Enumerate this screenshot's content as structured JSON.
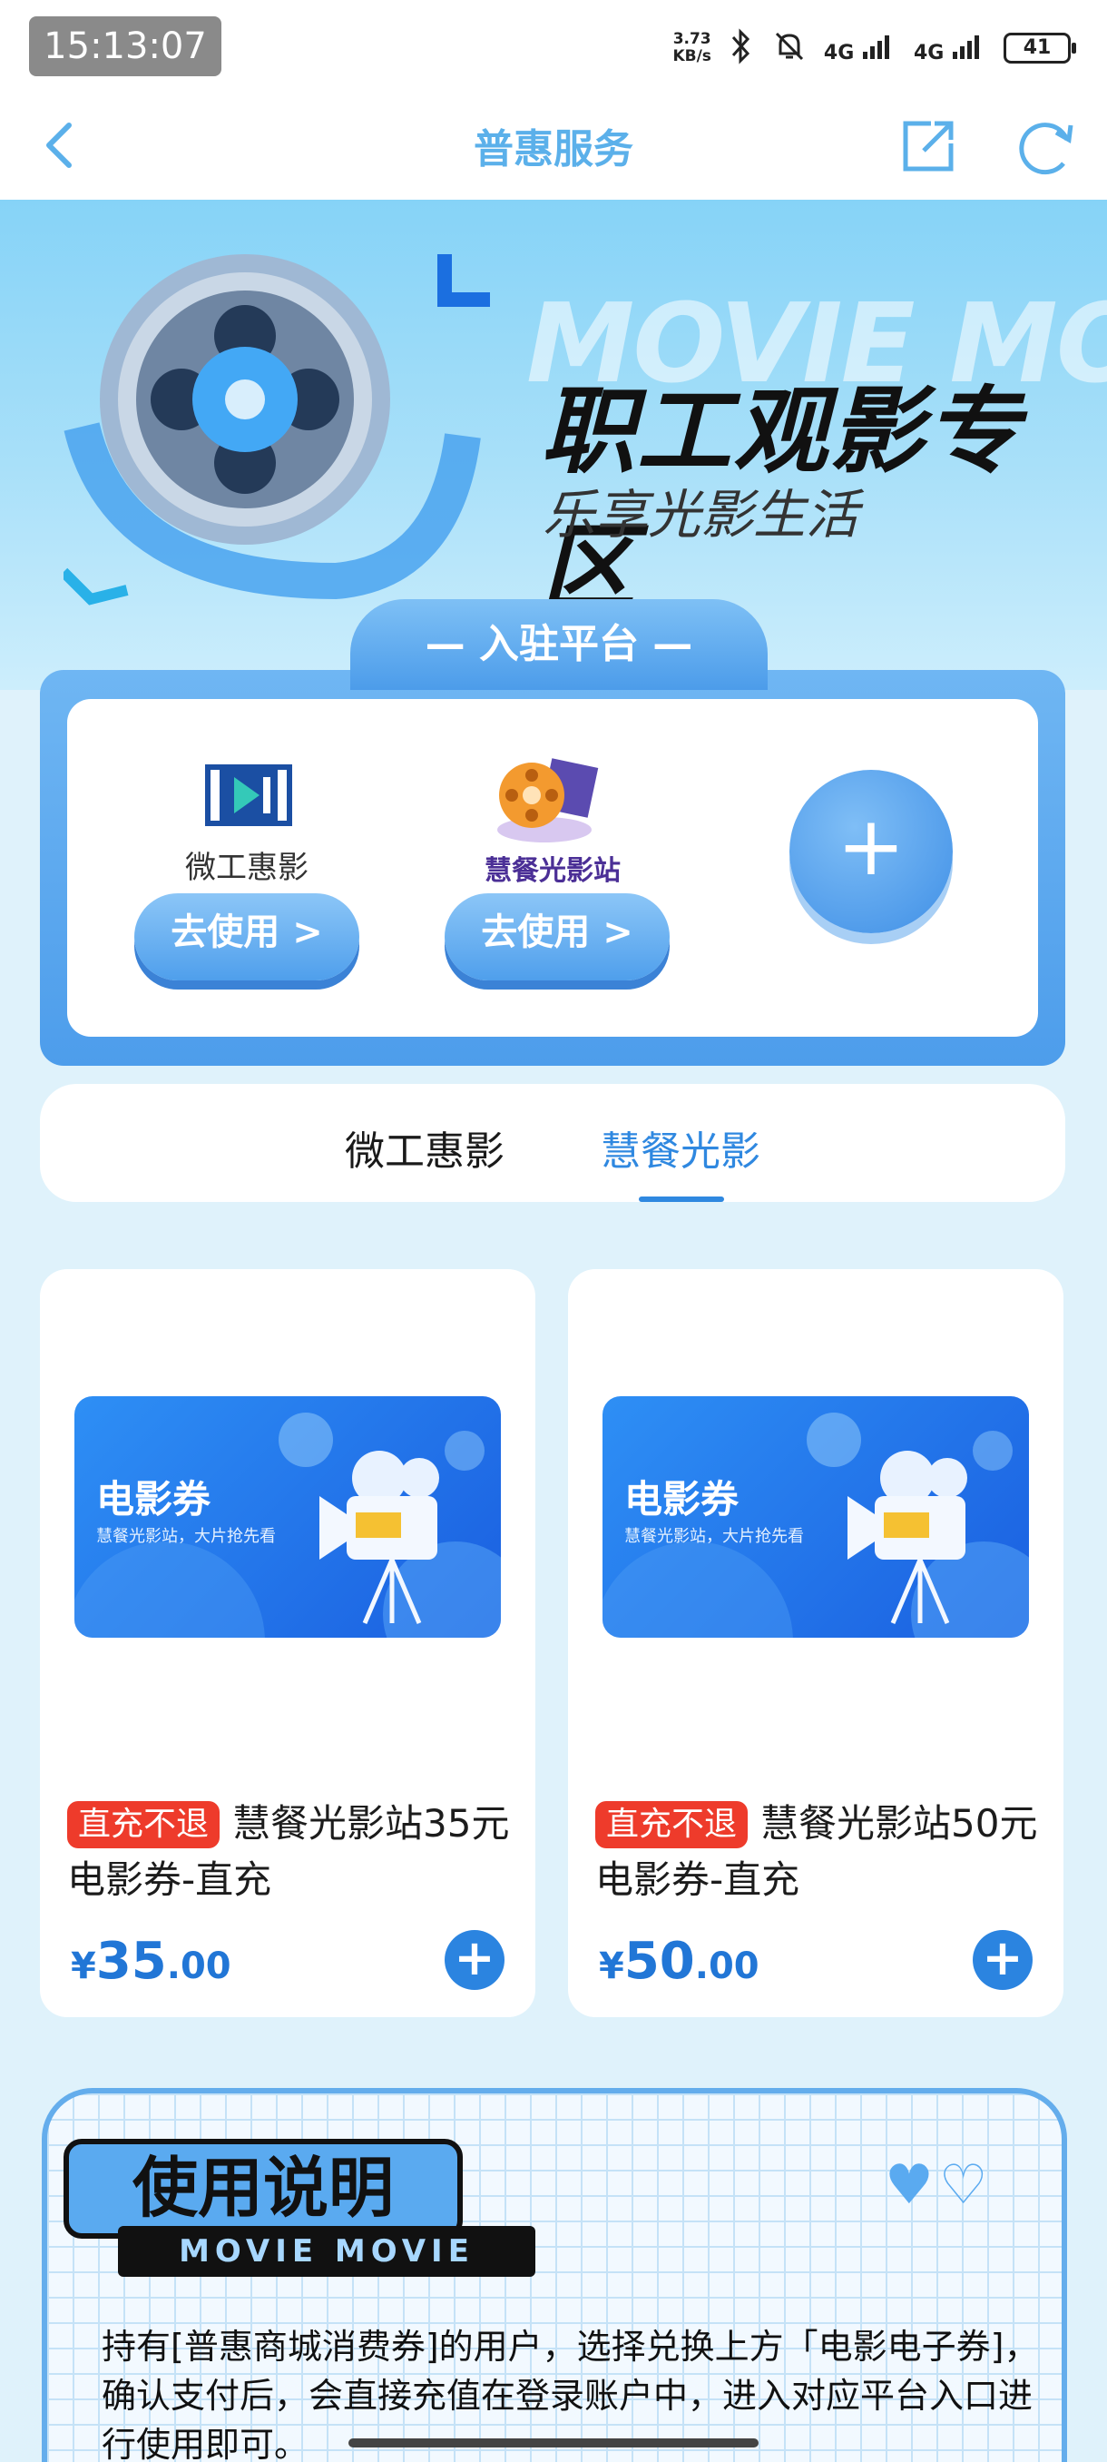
{
  "status": {
    "time": "15:13:07",
    "speed_top": "3.73",
    "speed_bottom": "KB/s",
    "sig1": "4G",
    "sig2": "4G",
    "battery": "41"
  },
  "nav": {
    "title": "普惠服务"
  },
  "hero": {
    "bg_text": "MOVIE MOVIE",
    "title": "职工观影专区",
    "subtitle": "乐享光影生活"
  },
  "platforms": {
    "header": "— 入驻平台 —",
    "items": [
      {
        "name": "微工惠影",
        "button": "去使用 >"
      },
      {
        "name": "慧餐光影站",
        "button": "去使用 >"
      }
    ],
    "add_label": "+"
  },
  "tabs": [
    {
      "label": "微工惠影",
      "active": false
    },
    {
      "label": "慧餐光影",
      "active": true
    }
  ],
  "products": [
    {
      "ticket_title": "电影券",
      "ticket_sub": "慧餐光影站，大片抢先看",
      "badge": "直充不退",
      "name": "慧餐光影站35元电影券-直充",
      "currency": "¥",
      "price_int": "35",
      "price_dec": ".00"
    },
    {
      "ticket_title": "电影券",
      "ticket_sub": "慧餐光影站，大片抢先看",
      "badge": "直充不退",
      "name": "慧餐光影站50元电影券-直充",
      "currency": "¥",
      "price_int": "50",
      "price_dec": ".00"
    }
  ],
  "usage": {
    "title": "使用说明",
    "subtitle": "MOVIE MOVIE",
    "text": "持有[普惠商城消费券]的用户，选择兑换上方「电影电子券]，确认支付后，会直接充值在登录账户中，进入对应平台入口进行使用即可。"
  },
  "colors": {
    "accent": "#2f88e0",
    "nav_title": "#5bb0ea",
    "badge": "#ee3b2b",
    "price": "#2176d6"
  }
}
